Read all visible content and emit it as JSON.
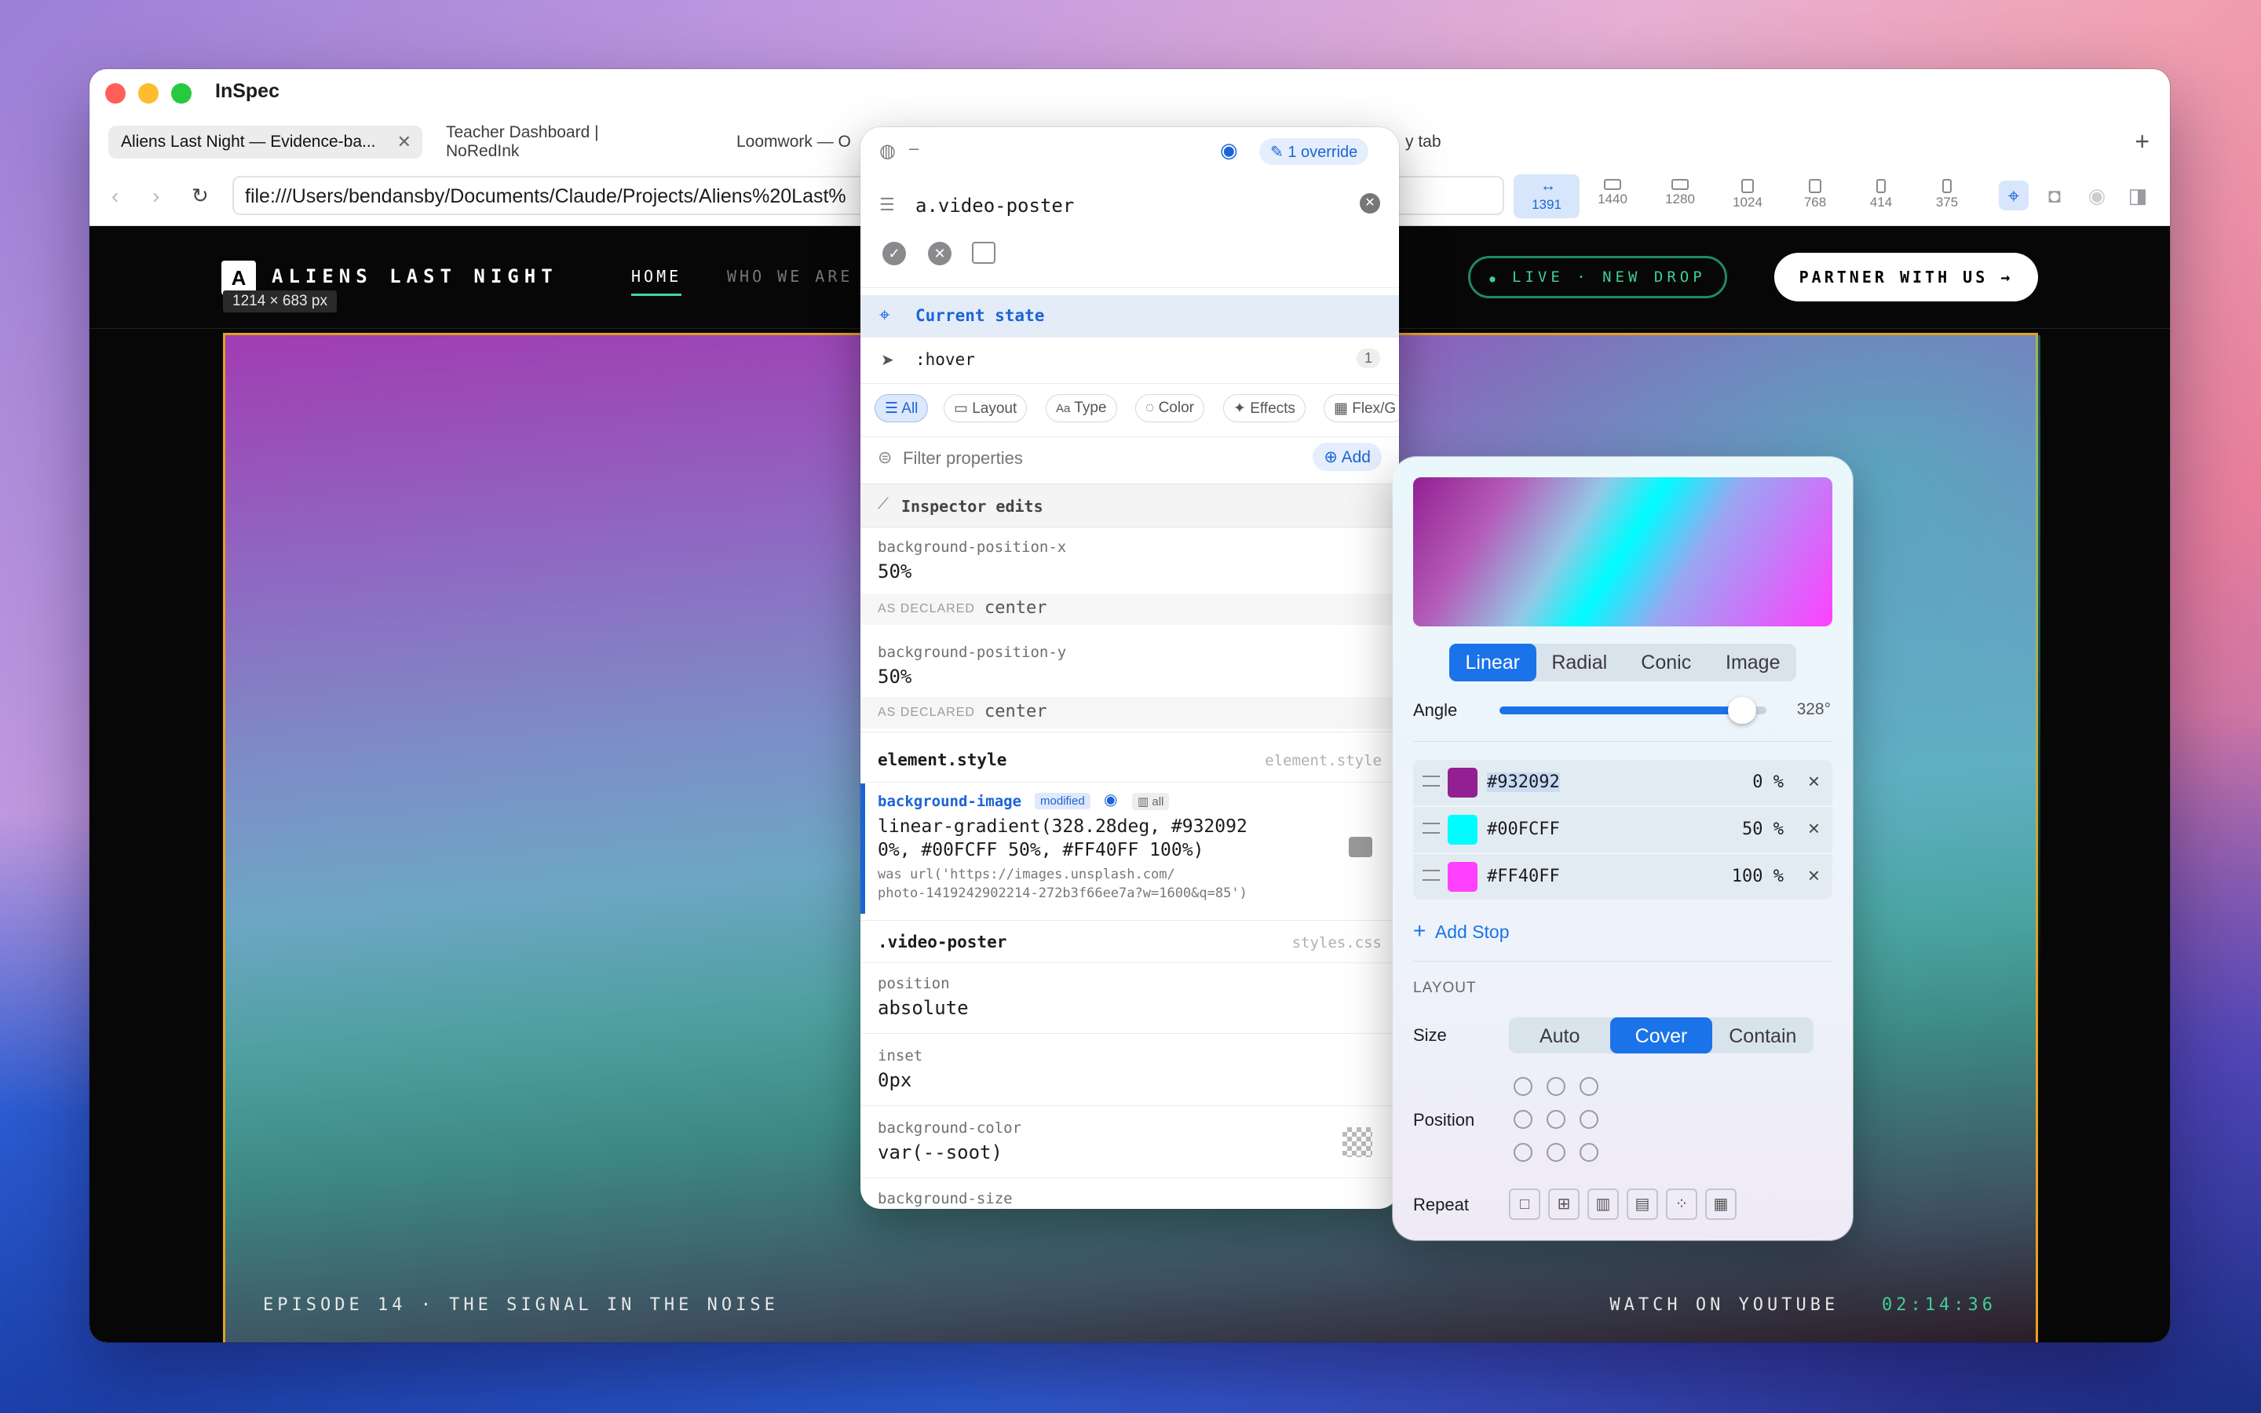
{
  "app": {
    "title": "InSpec"
  },
  "tabs": [
    {
      "label": "Aliens Last Night — Evidence-ba...",
      "active": true
    },
    {
      "label": "Teacher Dashboard | NoRedInk"
    },
    {
      "label": "Loomwork — O"
    },
    {
      "label": "y tab"
    }
  ],
  "toolbar": {
    "url": "file:///Users/bendansby/Documents/Claude/Projects/Aliens%20Last%",
    "viewports": [
      "1391",
      "1440",
      "1280",
      "1024",
      "768",
      "414",
      "375"
    ],
    "selected_viewport": "1391"
  },
  "site": {
    "logo_letter": "A",
    "logo_text": "ALIENS LAST NIGHT",
    "dimensions": "1214 × 683 px",
    "nav": [
      "HOME",
      "WHO WE ARE"
    ],
    "live_badge": "LIVE · NEW DROP",
    "partner_button": "PARTNER WITH US →",
    "caption_left": "EPISODE 14  ·  THE SIGNAL IN THE NOISE",
    "caption_right": "WATCH ON YOUTUBE",
    "timestamp": "02:14:36"
  },
  "inspector": {
    "dash": "–",
    "override_badge": "1 override",
    "selector": "a.video-poster",
    "current_state": "Current state",
    "hover_state": ":hover",
    "hover_count": "1",
    "filters": [
      "All",
      "Layout",
      "Type",
      "Color",
      "Effects",
      "Flex/G"
    ],
    "filter_placeholder": "Filter properties",
    "add_label": "Add",
    "inspector_edits": "Inspector edits",
    "edits": [
      {
        "name": "background-position-x",
        "value": "50%",
        "declared_label": "AS DECLARED",
        "declared": "center"
      },
      {
        "name": "background-position-y",
        "value": "50%",
        "declared_label": "AS DECLARED",
        "declared": "center"
      }
    ],
    "element_style": "element.style",
    "element_style_src": "element.style",
    "bg_prop": "background-image",
    "modified_badge": "modified",
    "all_badge": "all",
    "bg_value_line1": "linear-gradient(328.28deg, #932092",
    "bg_value_line2": "0%, #00FCFF 50%, #FF40FF 100%)",
    "was_line1": "was url('https://images.unsplash.com/",
    "was_line2": "photo-1419242902214-272b3f66ee7a?w=1600&q=85')",
    "rule_selector": ".video-poster",
    "rule_src": "styles.css",
    "rule_props": [
      {
        "name": "position",
        "value": "absolute"
      },
      {
        "name": "inset",
        "value": "0px"
      },
      {
        "name": "background-color",
        "value": "var(--soot)"
      },
      {
        "name": "background-size",
        "value": ""
      }
    ]
  },
  "gradient": {
    "types": [
      "Linear",
      "Radial",
      "Conic",
      "Image"
    ],
    "selected_type": "Linear",
    "angle_label": "Angle",
    "angle_value": "328°",
    "angle_fraction": 0.91,
    "stops": [
      {
        "hex": "#932092",
        "pos": "0",
        "color": "#932092"
      },
      {
        "hex": "#00FCFF",
        "pos": "50",
        "color": "#00FCFF"
      },
      {
        "hex": "#FF40FF",
        "pos": "100",
        "color": "#FF40FF"
      }
    ],
    "pct_unit": "%",
    "add_stop": "Add Stop",
    "layout_heading": "LAYOUT",
    "size_label": "Size",
    "size_options": [
      "Auto",
      "Cover",
      "Contain"
    ],
    "selected_size": "Cover",
    "position_label": "Position",
    "repeat_label": "Repeat"
  },
  "colors": {
    "accent": "#1a73e8",
    "live_green": "#3fcf95",
    "poster_outline": "#e6a21d"
  }
}
